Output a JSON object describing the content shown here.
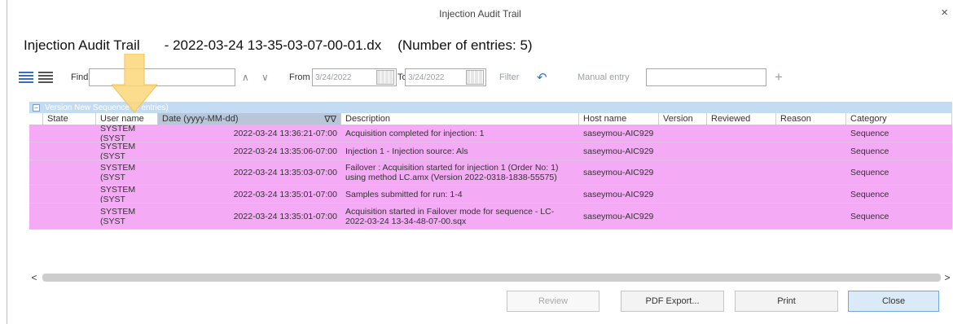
{
  "window": {
    "title": "Injection Audit Trail",
    "close_glyph": "×"
  },
  "heading": {
    "label": "Injection Audit Trail",
    "file": "- 2022-03-24 13-35-03-07-00-01.dx",
    "count": "(Number of entries: 5)"
  },
  "toolbar": {
    "find_label": "Find",
    "find_value": "",
    "up_glyph": "∧",
    "down_glyph": "∨",
    "from_label": "From",
    "from_value": "3/24/2022",
    "to_label": "To",
    "to_value": "3/24/2022",
    "filter_label": "Filter",
    "undo_glyph": "↶",
    "manual_entry_label": "Manual entry",
    "manual_entry_value": "",
    "add_glyph": "+"
  },
  "group": {
    "toggle": "−",
    "label": "Version  New Sequence  (5 entries)"
  },
  "columns": {
    "state": "State",
    "user": "User name",
    "date": "Date (yyyy-MM-dd)",
    "sort_glyph": "∇∇",
    "description": "Description",
    "host": "Host name",
    "version": "Version",
    "reviewed": "Reviewed",
    "reason": "Reason",
    "category": "Category"
  },
  "rows": [
    {
      "state": "",
      "user": "SYSTEM (SYST",
      "date": "2022-03-24 13:36:21-07:00",
      "description": "Acquisition completed for injection: 1",
      "host": "saseymou-AIC929",
      "version": "",
      "reviewed": "",
      "reason": "",
      "category": "Sequence"
    },
    {
      "state": "",
      "user": "SYSTEM (SYST",
      "date": "2022-03-24 13:35:06-07:00",
      "description": "Injection 1 - Injection source: Als",
      "host": "saseymou-AIC929",
      "version": "",
      "reviewed": "",
      "reason": "",
      "category": "Sequence"
    },
    {
      "state": "",
      "user": "SYSTEM (SYST",
      "date": "2022-03-24 13:35:03-07:00",
      "description": "Failover : Acquisition started for injection 1 (Order No: 1) using method LC.amx (Version 2022-0318-1838-55575)",
      "host": "saseymou-AIC929",
      "version": "",
      "reviewed": "",
      "reason": "",
      "category": "Sequence"
    },
    {
      "state": "",
      "user": "SYSTEM (SYST",
      "date": "2022-03-24 13:35:01-07:00",
      "description": "Samples submitted for run: 1-4",
      "host": "saseymou-AIC929",
      "version": "",
      "reviewed": "",
      "reason": "",
      "category": "Sequence"
    },
    {
      "state": "",
      "user": "SYSTEM (SYST",
      "date": "2022-03-24 13:35:01-07:00",
      "description": "Acquisition started in Failover mode for sequence - LC-2022-03-24 13-34-48-07-00.sqx",
      "host": "saseymou-AIC929",
      "version": "",
      "reviewed": "",
      "reason": "",
      "category": "Sequence"
    }
  ],
  "scroll": {
    "left_glyph": "<",
    "right_glyph": ">"
  },
  "buttons": {
    "review": "Review",
    "pdf_export": "PDF Export...",
    "print": "Print",
    "close": "Close"
  },
  "colors": {
    "row_highlight": "#f4aaf4",
    "group_header": "#c3dcf3",
    "callout_arrow": "#fcd77a"
  }
}
